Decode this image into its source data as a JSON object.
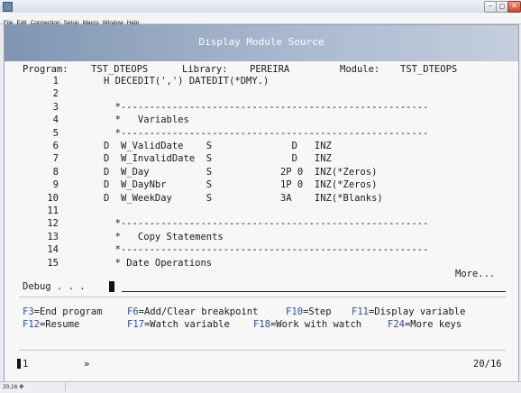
{
  "menu": [
    "File",
    "Edit",
    "Connection",
    "Setup",
    "Macro",
    "Window",
    "Help"
  ],
  "window_buttons": {
    "minimize": "–",
    "maximize": "◻",
    "close": "✕"
  },
  "screen": {
    "title": "Display Module Source",
    "program_label": "Program:",
    "program": "TST_DTEOPS",
    "library_label": "Library:",
    "library": "PEREIRA",
    "module_label": "Module:",
    "module": "TST_DTEOPS"
  },
  "source_lines": [
    {
      "num": "1",
      "text": "H DECEDIT(',') DATEDIT(*DMY.)"
    },
    {
      "num": "2",
      "text": ""
    },
    {
      "num": "3",
      "text": "  *------------------------------------------------------"
    },
    {
      "num": "4",
      "text": "  *   Variables"
    },
    {
      "num": "5",
      "text": "  *------------------------------------------------------"
    },
    {
      "num": "6",
      "text": "D  W_ValidDate    S              D   INZ"
    },
    {
      "num": "7",
      "text": "D  W_InvalidDate  S              D   INZ"
    },
    {
      "num": "8",
      "text": "D  W_Day          S            2P 0  INZ(*Zeros)"
    },
    {
      "num": "9",
      "text": "D  W_DayNbr       S            1P 0  INZ(*Zeros)"
    },
    {
      "num": "10",
      "text": "D  W_WeekDay      S            3A    INZ(*Blanks)"
    },
    {
      "num": "11",
      "text": ""
    },
    {
      "num": "12",
      "text": "  *------------------------------------------------------"
    },
    {
      "num": "13",
      "text": "  *   Copy Statements"
    },
    {
      "num": "14",
      "text": "  *------------------------------------------------------"
    },
    {
      "num": "15",
      "text": "  * Date Operations"
    }
  ],
  "more": "More...",
  "debug_label": "Debug . . .",
  "function_keys": [
    {
      "key": "F3",
      "label": "=End program"
    },
    {
      "key": "F6",
      "label": "=Add/Clear breakpoint"
    },
    {
      "key": "F10",
      "label": "=Step"
    },
    {
      "key": "F11",
      "label": "=Display variable"
    },
    {
      "key": "F12",
      "label": "=Resume"
    },
    {
      "key": "F17",
      "label": "=Watch variable"
    },
    {
      "key": "F18",
      "label": "=Work with watch"
    },
    {
      "key": "F24",
      "label": "=More keys"
    }
  ],
  "status": {
    "session": "1",
    "shift_glyph": "»",
    "cursor_pos": "20/16"
  },
  "statusbar_text": "20,16 ✥"
}
